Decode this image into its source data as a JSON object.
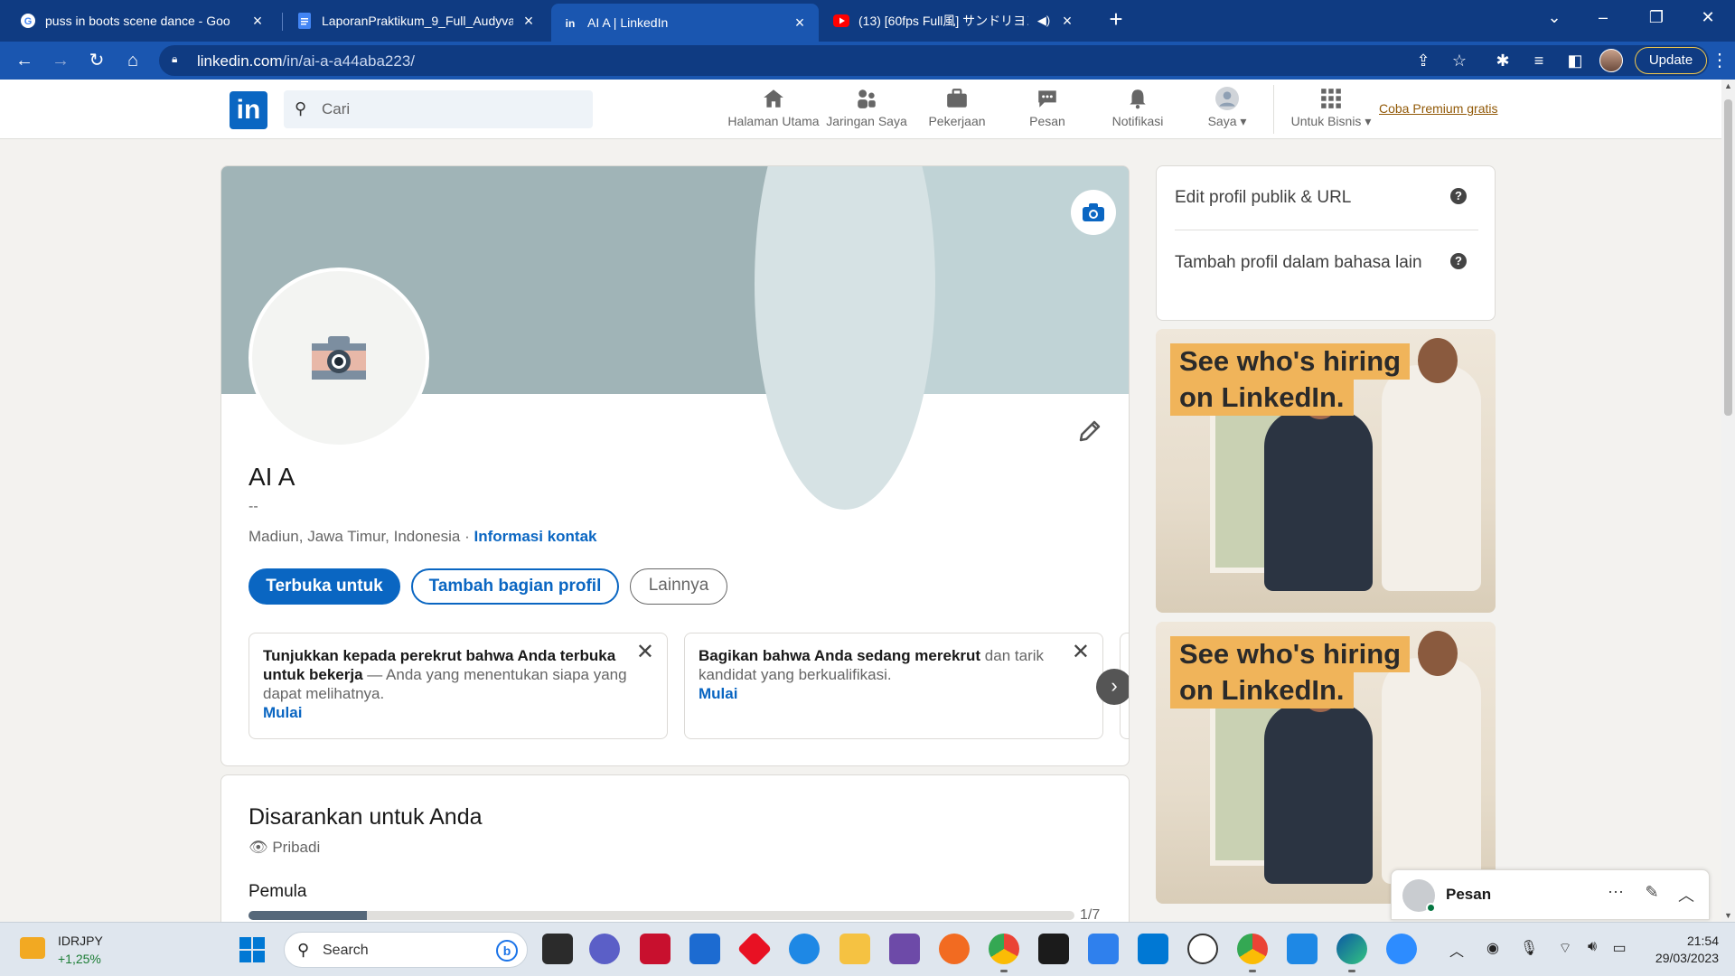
{
  "browser": {
    "tabs": [
      {
        "title": "puss in boots scene dance - Goo",
        "icon": "google-icon"
      },
      {
        "title": "LaporanPraktikum_9_Full_Audyva",
        "icon": "docs-icon"
      },
      {
        "title": "AI A | LinkedIn",
        "icon": "linkedin-icon"
      },
      {
        "title": "(13) [60fps Full風] サンドリヨン",
        "icon": "youtube-icon"
      }
    ],
    "url_host": "linkedin.com",
    "url_path": "/in/ai-a-a44aba223/",
    "update_label": "Update"
  },
  "nav": {
    "search_placeholder": "Cari",
    "items": [
      {
        "label": "Halaman Utama",
        "icon": "home-icon"
      },
      {
        "label": "Jaringan Saya",
        "icon": "network-icon"
      },
      {
        "label": "Pekerjaan",
        "icon": "briefcase-icon"
      },
      {
        "label": "Pesan",
        "icon": "message-icon"
      },
      {
        "label": "Notifikasi",
        "icon": "bell-icon"
      },
      {
        "label": "Saya",
        "icon": "avatar-icon"
      },
      {
        "label": "Untuk Bisnis",
        "icon": "grid-icon"
      }
    ],
    "premium_label": "Coba Premium gratis"
  },
  "profile": {
    "name": "AI A",
    "headline": "--",
    "location": "Madiun, Jawa Timur, Indonesia",
    "location_sep": " · ",
    "contact_link": "Informasi kontak",
    "buttons": {
      "open_to": "Terbuka untuk",
      "add_section": "Tambah bagian profil",
      "more": "Lainnya"
    },
    "prompts": [
      {
        "bold1": "Tunjukkan kepada perekrut bahwa Anda terbuka untuk bekerja",
        "rest": " — Anda yang menentukan siapa yang dapat melihatnya.",
        "link": "Mulai"
      },
      {
        "bold1": "Bagikan bahwa Anda sedang merekrut",
        "rest": " dan tarik kandidat yang berkualifikasi.",
        "link": "Mulai"
      }
    ]
  },
  "suggested": {
    "title": "Disarankan untuk Anda",
    "visibility": "Pribadi",
    "level": "Pemula",
    "progress_text": "1/7",
    "progress_value": 0.143
  },
  "rail": {
    "edit_public": "Edit profil publik & URL",
    "add_language": "Tambah profil dalam bahasa lain",
    "ad_lines": [
      "See who's hiring",
      "on LinkedIn."
    ]
  },
  "messaging": {
    "title": "Pesan"
  },
  "taskbar": {
    "ticker_name": "IDRJPY",
    "ticker_change": "+1,25%",
    "search_label": "Search",
    "time": "21:54",
    "date": "29/03/2023"
  },
  "colors": {
    "linkedin_blue": "#0a66c2",
    "chrome_frame": "#0f3b82",
    "chrome_toolbar": "#1a56b0",
    "premium": "#915907"
  }
}
